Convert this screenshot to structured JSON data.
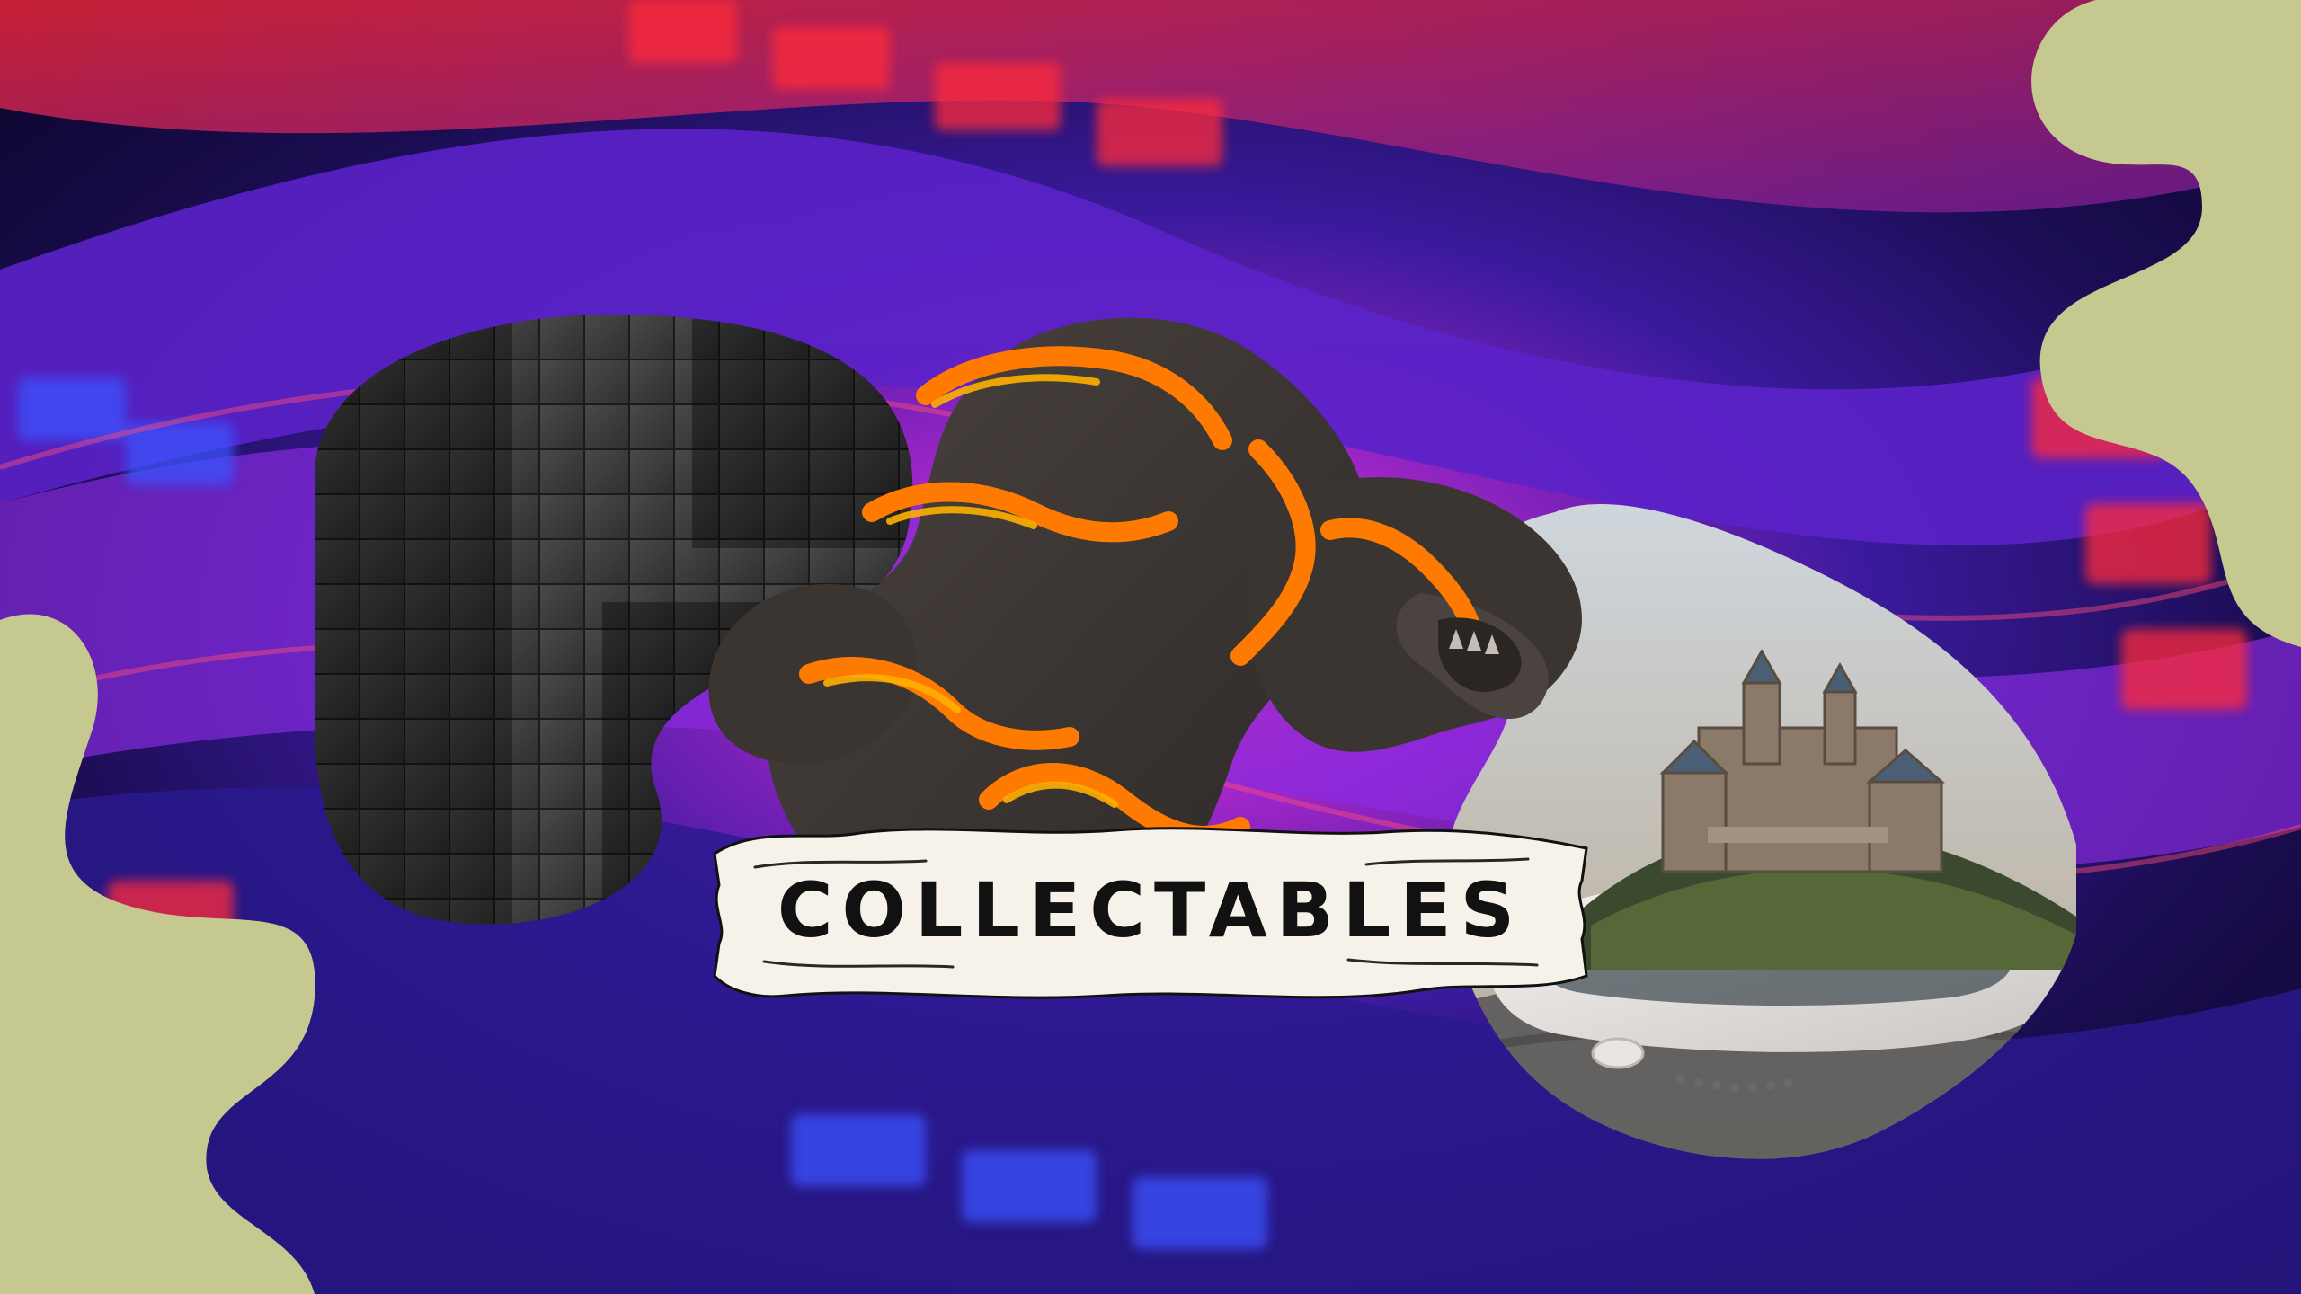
{
  "banner": {
    "title": "COLLECTABLES"
  },
  "colors": {
    "background_dark": "#1a0630",
    "neon_red": "#ff2a3a",
    "neon_blue": "#3b52ff",
    "neon_purple": "#8a2be2",
    "blob_green": "#c6c98f",
    "banner_paper": "#f6f1e9",
    "ink": "#111111",
    "lava_orange": "#ff7a00",
    "monster_dark": "#3b3532"
  },
  "images": {
    "left_blob": "dark-3d-cubes-wall-image",
    "center": "lava-rock-monster-image",
    "right_blob": "smartphone-with-castle-image"
  },
  "icons": {
    "top_right": "green-wavy-blob-shape",
    "bottom_left": "green-wavy-blob-shape"
  }
}
